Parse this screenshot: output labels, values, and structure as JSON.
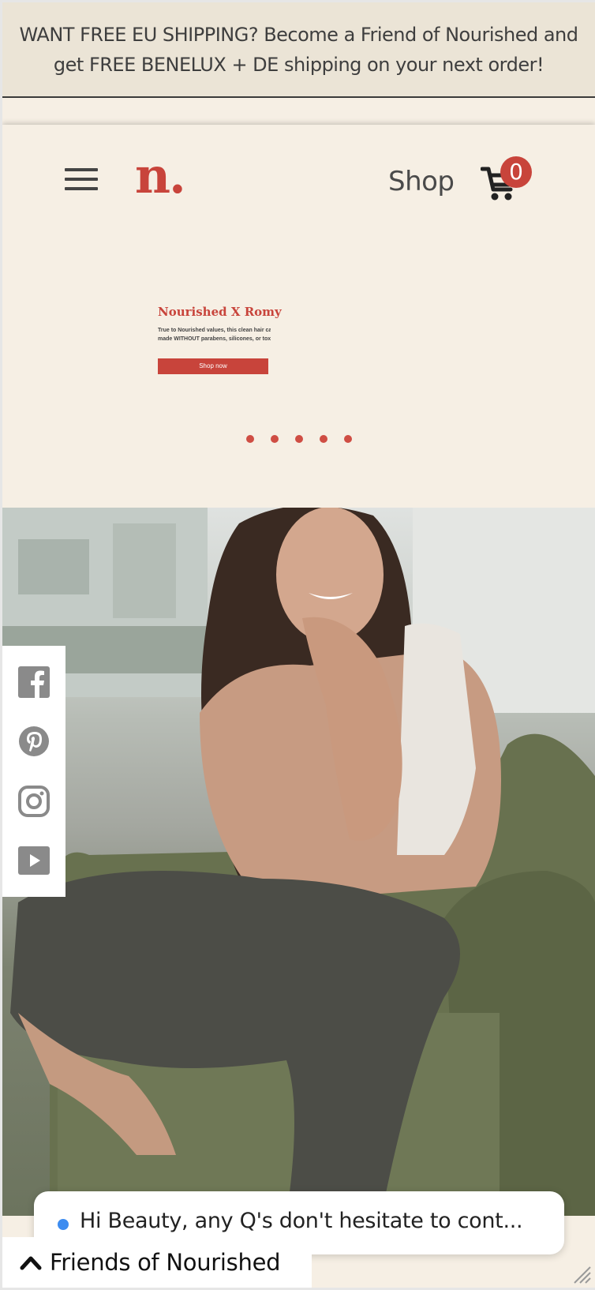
{
  "announcement": {
    "text": "WANT FREE EU SHIPPING? Become a Friend of Nourished and get FREE BENELUX + DE shipping on your next order!"
  },
  "header": {
    "logo_text": "n.",
    "shop_label": "Shop",
    "cart_count": "0"
  },
  "hero_slide": {
    "title": "Nourished X Romy",
    "text_line1": "True to Nourished values, this clean hair ca",
    "text_line2": "made WITHOUT parabens, silicones, or toxi",
    "button_label": "Shop now",
    "dot_count": 5
  },
  "social": {
    "icons": [
      "facebook-icon",
      "pinterest-icon",
      "instagram-icon",
      "youtube-icon"
    ]
  },
  "chat": {
    "message": "Hi Beauty, any Q's don't hesitate to cont..."
  },
  "friends_tab": {
    "label": "Friends of Nourished"
  },
  "colors": {
    "brand_red": "#c8443b",
    "background": "#f6efe4",
    "announcement_bg": "#ebe4d6",
    "chat_dot": "#3d8cf0"
  }
}
